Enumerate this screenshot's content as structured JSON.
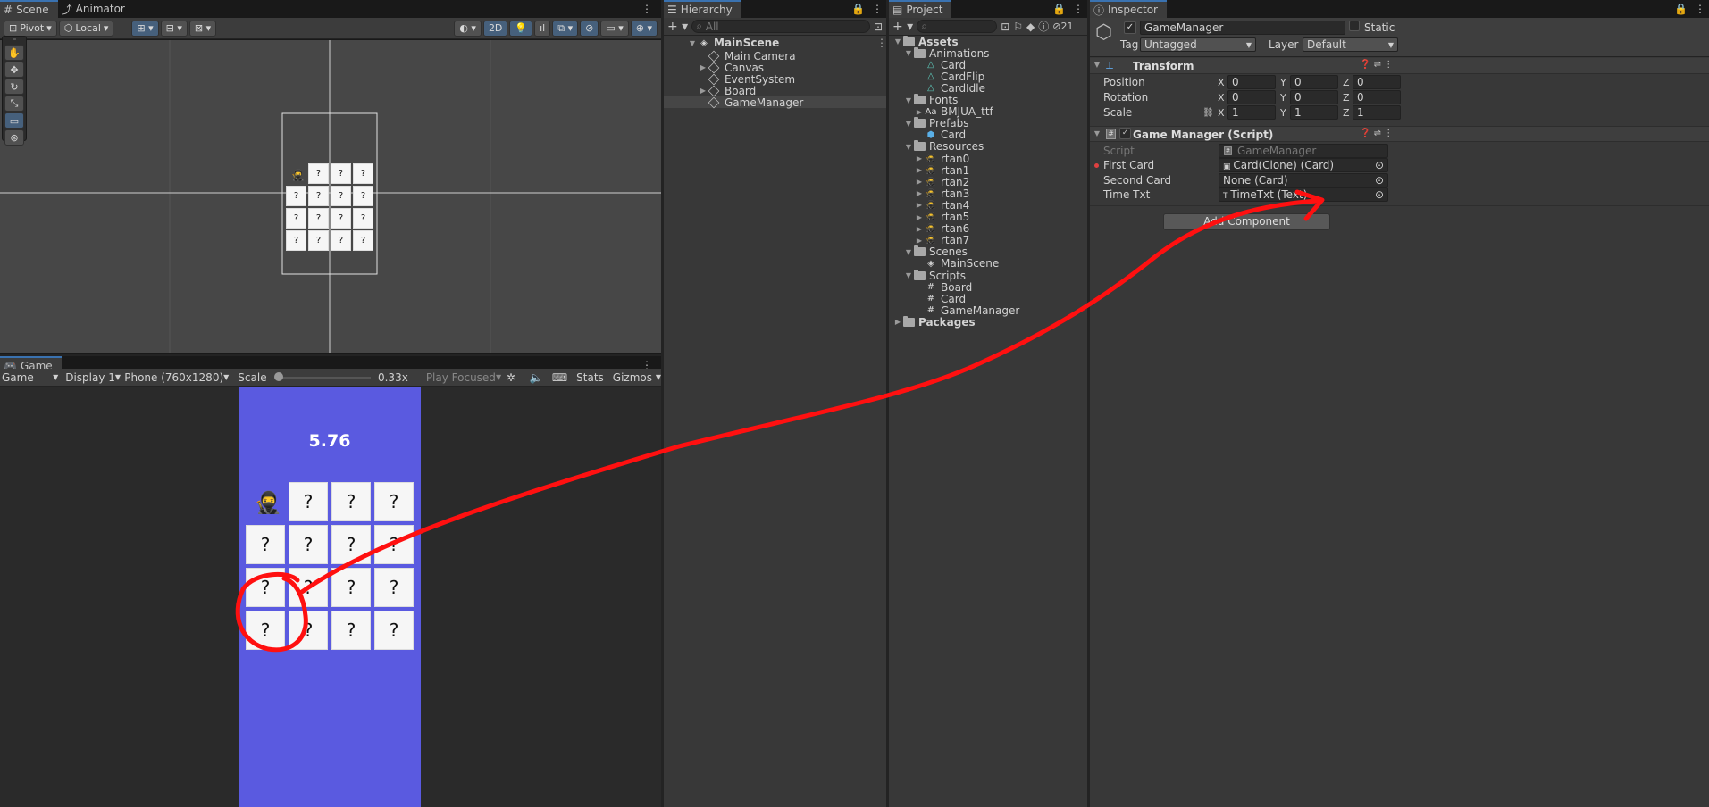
{
  "scene_panel": {
    "tabs": [
      {
        "label": "Scene",
        "icon": "grid-icon"
      },
      {
        "label": "Animator",
        "icon": "animator-icon"
      }
    ],
    "toolbar": {
      "pivot": "Pivot",
      "local": "Local",
      "mode_2d": "2D"
    },
    "cards": [
      "?",
      "?",
      "?",
      "?",
      "?",
      "?",
      "?",
      "?",
      "?",
      "?",
      "?",
      "?",
      "?",
      "?",
      "?"
    ]
  },
  "game_panel": {
    "tab": "Game",
    "toolbar": {
      "view": "Game",
      "display": "Display 1",
      "resolution": "Phone (760x1280)",
      "scale_label": "Scale",
      "scale_value": "0.33x",
      "play_mode": "Play Focused",
      "stats": "Stats",
      "gizmos": "Gizmos"
    },
    "timer": "5.76",
    "background_color": "#5a5ae0",
    "cards": [
      "?",
      "?",
      "?",
      "?",
      "?",
      "?",
      "?",
      "?",
      "?",
      "?",
      "?",
      "?",
      "?",
      "?",
      "?"
    ]
  },
  "hierarchy": {
    "tab": "Hierarchy",
    "search_placeholder": "All",
    "scene": "MainScene",
    "items": [
      "Main Camera",
      "Canvas",
      "EventSystem",
      "Board",
      "GameManager"
    ],
    "selected": "GameManager"
  },
  "project": {
    "tab": "Project",
    "hidden_count": "21",
    "tree": [
      {
        "label": "Assets",
        "type": "folder",
        "level": 0,
        "bold": true
      },
      {
        "label": "Animations",
        "type": "folder",
        "level": 1
      },
      {
        "label": "Card",
        "type": "anim",
        "level": 2
      },
      {
        "label": "CardFlip",
        "type": "anim",
        "level": 2
      },
      {
        "label": "CardIdle",
        "type": "anim",
        "level": 2
      },
      {
        "label": "Fonts",
        "type": "folder",
        "level": 1
      },
      {
        "label": "BMJUA_ttf",
        "type": "font",
        "level": 2
      },
      {
        "label": "Prefabs",
        "type": "folder",
        "level": 1
      },
      {
        "label": "Card",
        "type": "prefab",
        "level": 2
      },
      {
        "label": "Resources",
        "type": "folder",
        "level": 1
      },
      {
        "label": "rtan0",
        "type": "sprite",
        "level": 2
      },
      {
        "label": "rtan1",
        "type": "sprite",
        "level": 2
      },
      {
        "label": "rtan2",
        "type": "sprite",
        "level": 2
      },
      {
        "label": "rtan3",
        "type": "sprite",
        "level": 2
      },
      {
        "label": "rtan4",
        "type": "sprite",
        "level": 2
      },
      {
        "label": "rtan5",
        "type": "sprite",
        "level": 2
      },
      {
        "label": "rtan6",
        "type": "sprite",
        "level": 2
      },
      {
        "label": "rtan7",
        "type": "sprite",
        "level": 2
      },
      {
        "label": "Scenes",
        "type": "folder",
        "level": 1
      },
      {
        "label": "MainScene",
        "type": "scene",
        "level": 2
      },
      {
        "label": "Scripts",
        "type": "folder",
        "level": 1
      },
      {
        "label": "Board",
        "type": "script",
        "level": 2
      },
      {
        "label": "Card",
        "type": "script",
        "level": 2
      },
      {
        "label": "GameManager",
        "type": "script",
        "level": 2
      },
      {
        "label": "Packages",
        "type": "folder",
        "level": 0,
        "bold": true
      }
    ]
  },
  "inspector": {
    "tab": "Inspector",
    "object_name": "GameManager",
    "static_label": "Static",
    "tag_label": "Tag",
    "tag_value": "Untagged",
    "layer_label": "Layer",
    "layer_value": "Default",
    "transform": {
      "title": "Transform",
      "position_label": "Position",
      "position": [
        "0",
        "0",
        "0"
      ],
      "rotation_label": "Rotation",
      "rotation": [
        "0",
        "0",
        "0"
      ],
      "scale_label": "Scale",
      "scale": [
        "1",
        "1",
        "1"
      ]
    },
    "component": {
      "title": "Game Manager (Script)",
      "script_label": "Script",
      "script_value": "GameManager",
      "first_card_label": "First Card",
      "first_card_value": "Card(Clone) (Card)",
      "second_card_label": "Second Card",
      "second_card_value": "None (Card)",
      "time_txt_label": "Time Txt",
      "time_txt_value": "TimeTxt (Text)"
    },
    "add_component": "Add Component"
  },
  "colors": {
    "annotation": "#ff1010",
    "accent": "#3a72b0"
  }
}
